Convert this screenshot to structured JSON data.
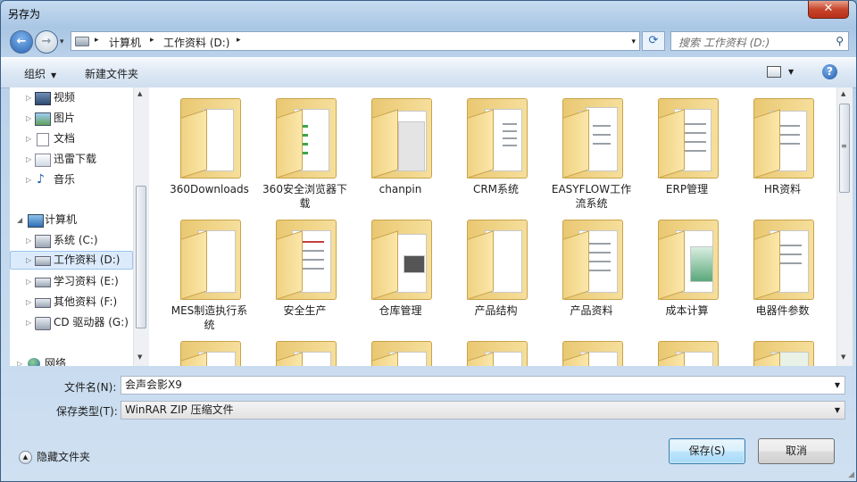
{
  "window": {
    "title": "另存为",
    "close_glyph": "✕"
  },
  "nav": {
    "back_glyph": "←",
    "forward_glyph": "→",
    "history_glyph": "▾",
    "breadcrumbs": [
      "计算机",
      "工作资料 (D:)"
    ],
    "separator": "▸",
    "dropdown_glyph": "▾",
    "refresh_glyph": "⟳",
    "search_placeholder": "搜索 工作资料 (D:)",
    "search_glyph": "⚲"
  },
  "toolbar": {
    "organize": "组织",
    "new_folder": "新建文件夹",
    "caret": "▼",
    "help": "?"
  },
  "navpane": {
    "items": [
      {
        "label": "视频",
        "icon": "video-library-icon",
        "expander": "▷"
      },
      {
        "label": "图片",
        "icon": "pictures-library-icon",
        "expander": "▷"
      },
      {
        "label": "文档",
        "icon": "documents-library-icon",
        "expander": "▷"
      },
      {
        "label": "迅雷下载",
        "icon": "downloads-library-icon",
        "expander": "▷"
      },
      {
        "label": "音乐",
        "icon": "music-library-icon",
        "expander": "▷"
      },
      {
        "label": "计算机",
        "icon": "computer-icon",
        "expander": "◢"
      },
      {
        "label": "系统 (C:)",
        "icon": "system-drive-icon",
        "expander": "▷"
      },
      {
        "label": "工作资料 (D:)",
        "icon": "drive-icon",
        "expander": "▷",
        "selected": true
      },
      {
        "label": "学习资料 (E:)",
        "icon": "drive-icon",
        "expander": "▷"
      },
      {
        "label": "其他资料 (F:)",
        "icon": "drive-icon",
        "expander": "▷"
      },
      {
        "label": "CD 驱动器 (G:)",
        "icon": "cd-drive-icon",
        "expander": "▷"
      },
      {
        "label": "网络",
        "icon": "network-icon",
        "expander": "▷"
      }
    ]
  },
  "folders": [
    {
      "line1": "360Downloads",
      "line2": "",
      "icon": "folder-icon"
    },
    {
      "line1": "360安全浏览器下",
      "line2": "载",
      "icon": "folder-icon"
    },
    {
      "line1": "chanpin",
      "line2": "",
      "icon": "folder-icon"
    },
    {
      "line1": "CRM系统",
      "line2": "",
      "icon": "folder-icon"
    },
    {
      "line1": "EASYFLOW工作",
      "line2": "流系统",
      "icon": "folder-icon"
    },
    {
      "line1": "ERP管理",
      "line2": "",
      "icon": "folder-icon"
    },
    {
      "line1": "HR资料",
      "line2": "",
      "icon": "folder-icon"
    },
    {
      "line1": "MES制造执行系",
      "line2": "统",
      "icon": "folder-icon"
    },
    {
      "line1": "安全生产",
      "line2": "",
      "icon": "folder-icon"
    },
    {
      "line1": "仓库管理",
      "line2": "",
      "icon": "folder-icon"
    },
    {
      "line1": "产品结构",
      "line2": "",
      "icon": "folder-icon"
    },
    {
      "line1": "产品资料",
      "line2": "",
      "icon": "folder-icon"
    },
    {
      "line1": "成本计算",
      "line2": "",
      "icon": "folder-icon"
    },
    {
      "line1": "电器件参数",
      "line2": "",
      "icon": "folder-icon"
    }
  ],
  "form": {
    "filename_label": "文件名(N):",
    "filename_value": "会声会影X9",
    "filetype_label": "保存类型(T):",
    "filetype_value": "WinRAR ZIP 压缩文件",
    "caret": "▼"
  },
  "footer": {
    "hide_folders": "隐藏文件夹",
    "hide_glyph": "▲",
    "save": "保存(S)",
    "cancel": "取消"
  },
  "scroll": {
    "up": "▲",
    "down": "▼",
    "grip": "≡"
  }
}
